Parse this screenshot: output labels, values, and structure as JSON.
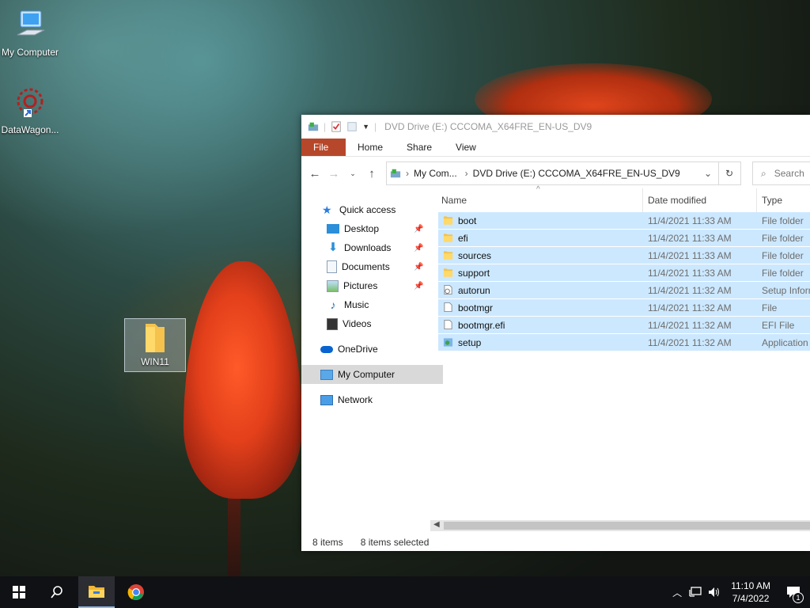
{
  "desktop": {
    "icons": [
      {
        "label": "My Computer"
      },
      {
        "label": "DataWagon..."
      },
      {
        "label": "WIN11"
      }
    ]
  },
  "explorer": {
    "title": "DVD Drive (E:) CCCOMA_X64FRE_EN-US_DV9",
    "tabs": [
      "File",
      "Home",
      "Share",
      "View"
    ],
    "address": {
      "crumbs": [
        "My Com...",
        "DVD Drive (E:) CCCOMA_X64FRE_EN-US_DV9"
      ]
    },
    "search_placeholder": "Search",
    "nav": [
      {
        "label": "Quick access"
      },
      {
        "label": "Desktop"
      },
      {
        "label": "Downloads"
      },
      {
        "label": "Documents"
      },
      {
        "label": "Pictures"
      },
      {
        "label": "Music"
      },
      {
        "label": "Videos"
      },
      {
        "label": "OneDrive"
      },
      {
        "label": "My Computer"
      },
      {
        "label": "Network"
      }
    ],
    "columns": {
      "name": "Name",
      "date": "Date modified",
      "type": "Type"
    },
    "files": [
      {
        "name": "boot",
        "date": "11/4/2021 11:33 AM",
        "type": "File folder"
      },
      {
        "name": "efi",
        "date": "11/4/2021 11:33 AM",
        "type": "File folder"
      },
      {
        "name": "sources",
        "date": "11/4/2021 11:33 AM",
        "type": "File folder"
      },
      {
        "name": "support",
        "date": "11/4/2021 11:33 AM",
        "type": "File folder"
      },
      {
        "name": "autorun",
        "date": "11/4/2021 11:32 AM",
        "type": "Setup Inform"
      },
      {
        "name": "bootmgr",
        "date": "11/4/2021 11:32 AM",
        "type": "File"
      },
      {
        "name": "bootmgr.efi",
        "date": "11/4/2021 11:32 AM",
        "type": "EFI File"
      },
      {
        "name": "setup",
        "date": "11/4/2021 11:32 AM",
        "type": "Application"
      }
    ],
    "status": {
      "items": "8 items",
      "selected": "8 items selected"
    }
  },
  "taskbar": {
    "time": "11:10 AM",
    "date": "7/4/2022",
    "notification_count": "1"
  },
  "colors": {
    "file_tab": "#b7472a",
    "selection": "#cce8ff",
    "taskbar": "#101114"
  }
}
